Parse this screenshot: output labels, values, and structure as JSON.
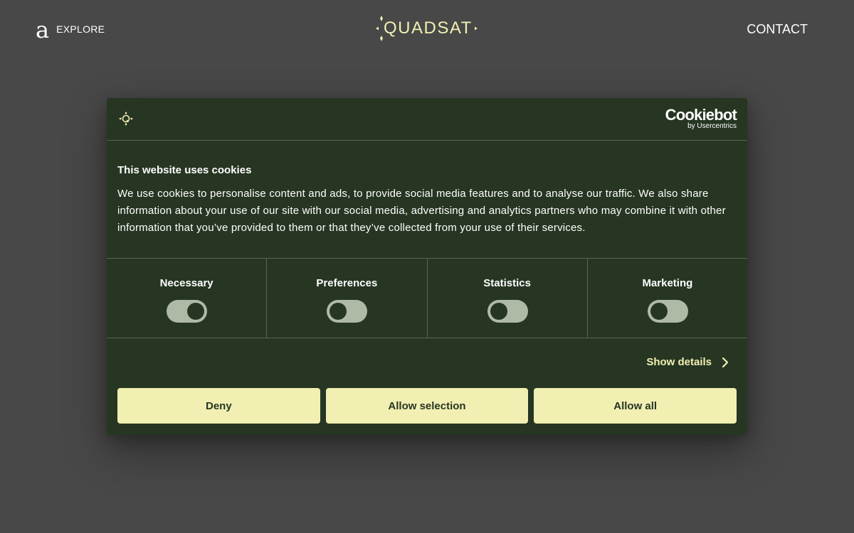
{
  "header": {
    "brand_letter": "a",
    "explore_label": "EXPLORE",
    "logo_text": "QUADSAT",
    "contact_label": "CONTACT"
  },
  "cookie_dialog": {
    "provider_name": "Cookiebot",
    "provider_sub": "by Usercentrics",
    "title": "This website uses cookies",
    "text": "We use cookies to personalise content and ads, to provide social media features and to analyse our traffic. We also share information about your use of our site with our social media, advertising and analytics partners who may combine it with other information that you’ve provided to them or that they’ve collected from your use of their services.",
    "categories": [
      {
        "label": "Necessary",
        "enabled": true
      },
      {
        "label": "Preferences",
        "enabled": false
      },
      {
        "label": "Statistics",
        "enabled": false
      },
      {
        "label": "Marketing",
        "enabled": false
      }
    ],
    "show_details_label": "Show details",
    "buttons": {
      "deny": "Deny",
      "allow_selection": "Allow selection",
      "allow_all": "Allow all"
    }
  },
  "colors": {
    "page_background": "#484848",
    "dialog_background": "#263622",
    "accent": "#f1efb2",
    "toggle_track": "#aebaa6"
  }
}
